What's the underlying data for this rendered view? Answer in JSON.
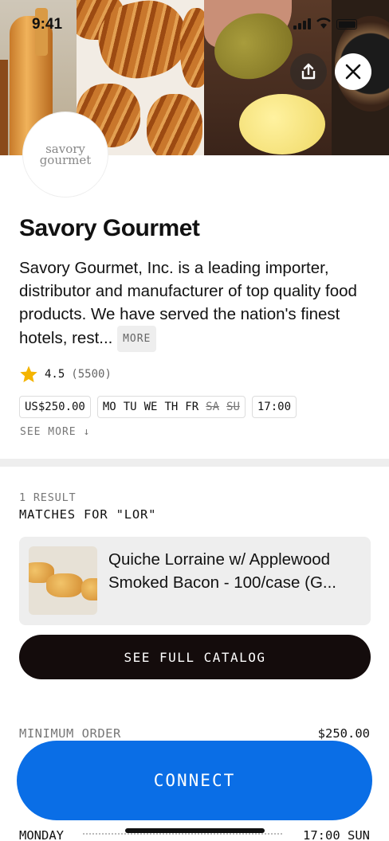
{
  "status_bar": {
    "time": "9:41"
  },
  "hero": {
    "images": [
      "sparkling-wine-bottles-photo",
      "croissants-photo",
      "butter-photo",
      "caviar-photo"
    ],
    "share_icon": "share-icon",
    "close_icon": "close-icon"
  },
  "vendor": {
    "logo_line1": "savory",
    "logo_line2": "gourmet",
    "name": "Savory Gourmet",
    "description": "Savory Gourmet, Inc. is a leading importer, distributor and manufacturer of top quality food products.  We have served the nation's finest hotels, rest...",
    "more_label": "MORE",
    "rating": "4.5",
    "rating_count": "(5500)",
    "min_order_tag": "US$250.00",
    "days": [
      {
        "label": "MO",
        "active": true
      },
      {
        "label": "TU",
        "active": true
      },
      {
        "label": "WE",
        "active": true
      },
      {
        "label": "TH",
        "active": true
      },
      {
        "label": "FR",
        "active": true
      },
      {
        "label": "SA",
        "active": false
      },
      {
        "label": "SU",
        "active": false
      }
    ],
    "cutoff_time": "17:00",
    "see_more_label": "SEE MORE ↓"
  },
  "search_results": {
    "count_label": "1 RESULT",
    "matches_label": "MATCHES FOR \"LOR\"",
    "items": [
      {
        "name": "Quiche Lorraine w/ Applewood Smoked Bacon - 100/case (G..."
      }
    ]
  },
  "catalog_button": "SEE FULL CATALOG",
  "details": {
    "min_order_label": "MINIMUM ORDER",
    "min_order_value": "$250.00",
    "monday_label": "MONDAY",
    "monday_value": "17:00 SUN"
  },
  "connect_button": "CONNECT",
  "colors": {
    "primary": "#0a6ee6",
    "dark_button": "#140c0c",
    "star": "#f4b400",
    "muted_text": "#777777",
    "divider": "#eeeeee"
  }
}
